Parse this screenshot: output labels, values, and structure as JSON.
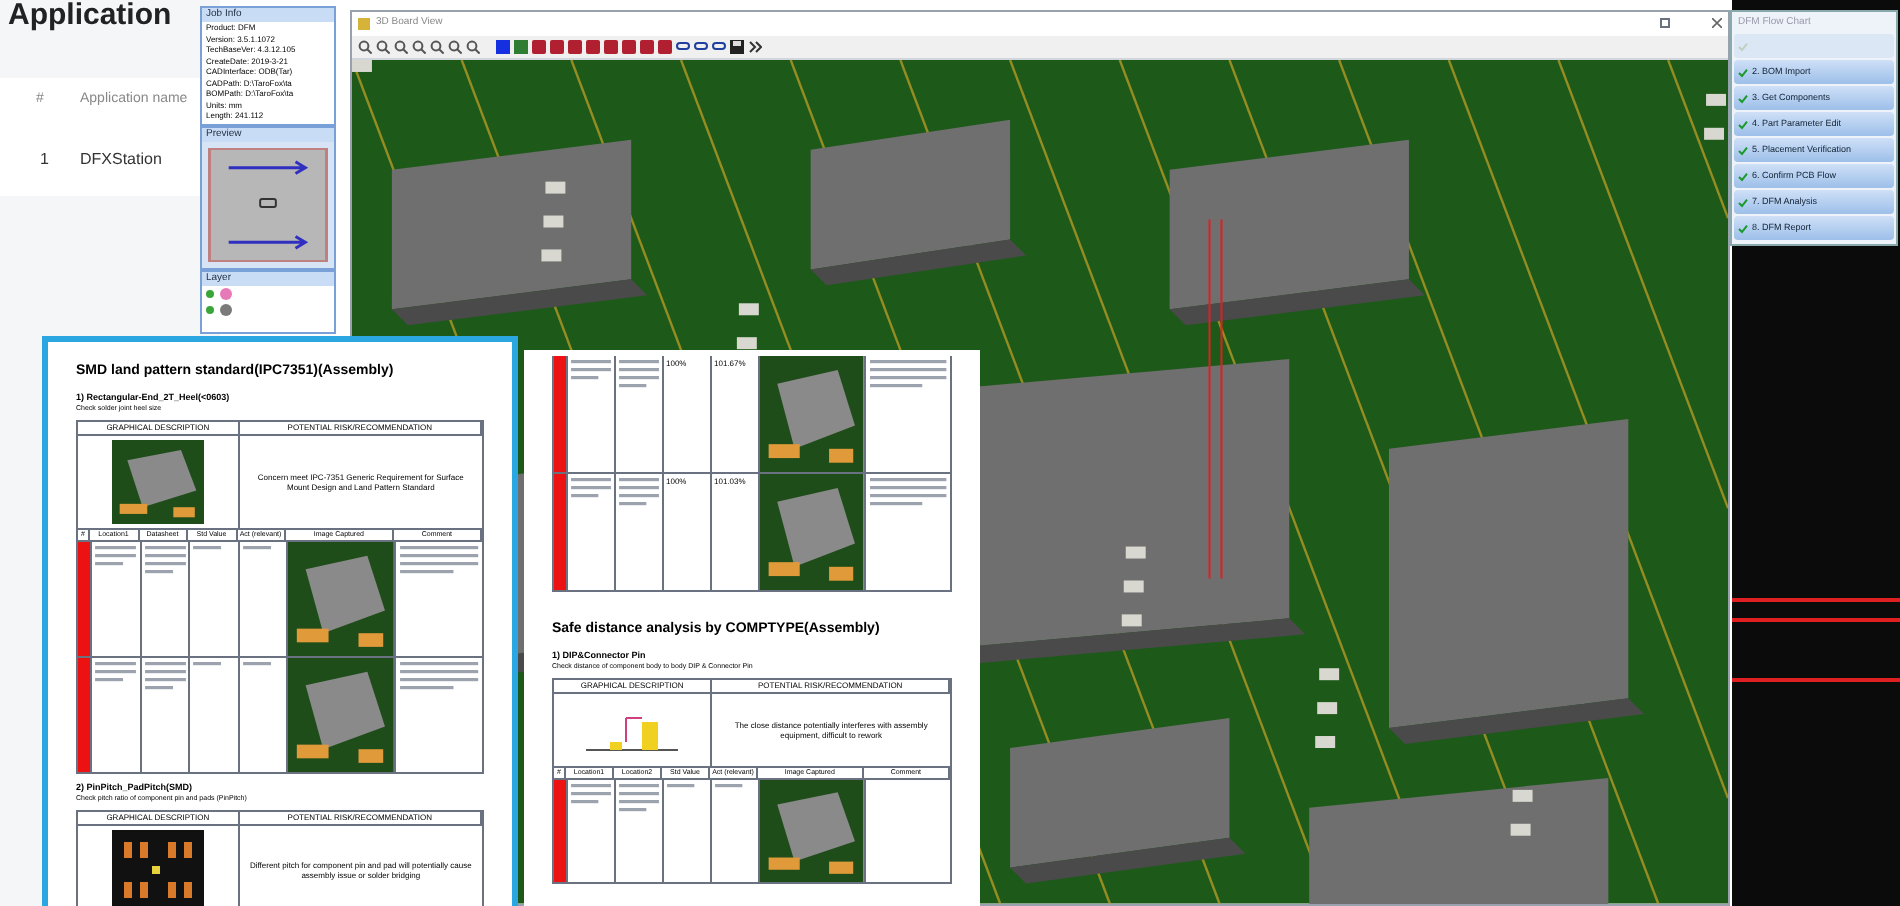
{
  "app_page": {
    "title": "Application",
    "columns": [
      "#",
      "Application name"
    ],
    "rows": [
      {
        "number": "1",
        "name": "DFXStation"
      }
    ]
  },
  "job_info": {
    "title": "Job Info",
    "lines": [
      "Product: DFM",
      "Version: 3.5.1.1072",
      "TechBaseVer: 4.3.12.105",
      "CreateDate: 2019-3-21",
      "CADInterface: ODB(Tar)",
      "CADPath: D:\\TaroFox\\ta",
      "BOMPath: D:\\TaroFox\\ta",
      "Units: mm",
      "Length: 241.112"
    ]
  },
  "preview": {
    "title": "Preview"
  },
  "layers": {
    "title": "Layer",
    "rows": [
      {
        "color": "#e879b9"
      },
      {
        "color": "#7a7a7a"
      }
    ]
  },
  "board_view": {
    "title": "3D Board View"
  },
  "flow_chart": {
    "title": "DFM Flow Chart",
    "steps": [
      {
        "selected": true
      },
      {
        "label": "2. BOM Import",
        "selected": false
      },
      {
        "label": "3. Get Components",
        "selected": false
      },
      {
        "label": "4. Part Parameter Edit",
        "selected": false
      },
      {
        "label": "5. Placement Verification",
        "selected": false
      },
      {
        "label": "6. Confirm PCB Flow",
        "selected": false
      },
      {
        "label": "7. DFM Analysis",
        "selected": false
      },
      {
        "label": "8. DFM Report",
        "selected": false
      }
    ]
  },
  "report_left": {
    "title": "SMD land pattern standard(IPC7351)(Assembly)",
    "sections": [
      {
        "heading": "1) Rectangular-End_2T_Heel(<0603)",
        "note": "Check solder joint heel size",
        "desc_headers": [
          "GRAPHICAL DESCRIPTION",
          "POTENTIAL RISK/RECOMMENDATION"
        ],
        "risk": "Concern meet IPC-7351 Generic Requirement for Surface Mount Design and Land Pattern Standard",
        "columns": [
          "#",
          "Location1",
          "Datasheet",
          "Std Value",
          "Act (relevant)",
          "Image Captured",
          "Comment"
        ]
      },
      {
        "heading": "2) PinPitch_PadPitch(SMD)",
        "note": "Check pitch ratio of component pin and pads (PinPitch)",
        "desc_headers": [
          "GRAPHICAL DESCRIPTION",
          "POTENTIAL RISK/RECOMMENDATION"
        ],
        "risk": "Different pitch for component pin and pad will potentially cause assembly issue or solder bridging"
      }
    ]
  },
  "report_right": {
    "rows": [
      {
        "value_1": "100%",
        "value_2": "101.67%"
      },
      {
        "value_1": "100%",
        "value_2": "101.03%"
      }
    ],
    "title": "Safe distance analysis by COMPTYPE(Assembly)",
    "section": {
      "heading": "1) DIP&Connector Pin",
      "note": "Check distance of component body to body DIP & Connector Pin",
      "desc_headers": [
        "GRAPHICAL DESCRIPTION",
        "POTENTIAL RISK/RECOMMENDATION"
      ],
      "risk": "The close distance potentially interferes with assembly equipment, difficult to rework",
      "columns": [
        "#",
        "Location1",
        "Location2",
        "Std Value",
        "Act (relevant)",
        "Image Captured",
        "Comment"
      ]
    }
  }
}
